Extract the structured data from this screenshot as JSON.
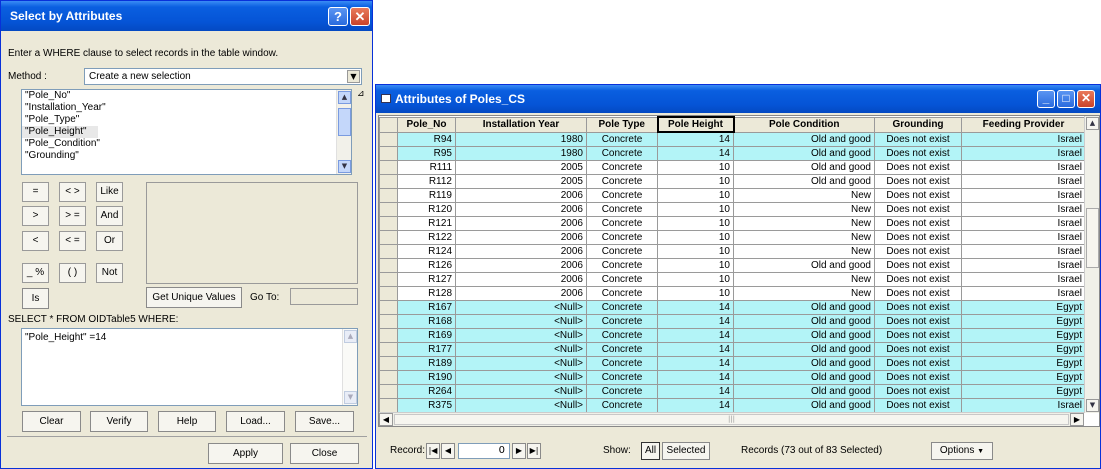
{
  "dialog": {
    "title": "Select by Attributes",
    "help_button": "?",
    "close_glyph": "✕",
    "instruction": "Enter a WHERE clause to select records in the table window.",
    "method_label": "Method :",
    "method_value": "Create a new selection",
    "fields": [
      "\"Pole_No\"",
      "\"Installation_Year\"",
      "\"Pole_Type\"",
      "\"Pole_Height\"",
      "\"Pole_Condition\"",
      "\"Grounding\""
    ],
    "selected_field_index": 3,
    "operators": [
      "=",
      "< >",
      "Like",
      ">",
      "> =",
      "And",
      "<",
      "< =",
      "Or",
      "_ %",
      "( )",
      "Not"
    ],
    "is_button": "Is",
    "get_unique_values": "Get Unique Values",
    "goto_label": "Go To:",
    "select_from": "SELECT * FROM OIDTable5 WHERE:",
    "where_clause": "\"Pole_Height\" =14",
    "buttons": {
      "clear": "Clear",
      "verify": "Verify",
      "help": "Help",
      "load": "Load...",
      "save": "Save..."
    },
    "apply": "Apply",
    "close": "Close"
  },
  "table_window": {
    "title": "Attributes of Poles_CS",
    "columns": [
      "Pole_No",
      "Installation Year",
      "Pole Type",
      "Pole Height",
      "Pole Condition",
      "Grounding",
      "Feeding Provider"
    ],
    "rows": [
      [
        "R94",
        "1980",
        "Concrete",
        "14",
        "Old and good",
        "Does not exist",
        "Israel"
      ],
      [
        "R95",
        "1980",
        "Concrete",
        "14",
        "Old and good",
        "Does not exist",
        "Israel"
      ],
      [
        "R111",
        "2005",
        "Concrete",
        "10",
        "Old and good",
        "Does not exist",
        "Israel"
      ],
      [
        "R112",
        "2005",
        "Concrete",
        "10",
        "Old and good",
        "Does not exist",
        "Israel"
      ],
      [
        "R119",
        "2006",
        "Concrete",
        "10",
        "New",
        "Does not exist",
        "Israel"
      ],
      [
        "R120",
        "2006",
        "Concrete",
        "10",
        "New",
        "Does not exist",
        "Israel"
      ],
      [
        "R121",
        "2006",
        "Concrete",
        "10",
        "New",
        "Does not exist",
        "Israel"
      ],
      [
        "R122",
        "2006",
        "Concrete",
        "10",
        "New",
        "Does not exist",
        "Israel"
      ],
      [
        "R124",
        "2006",
        "Concrete",
        "10",
        "New",
        "Does not exist",
        "Israel"
      ],
      [
        "R126",
        "2006",
        "Concrete",
        "10",
        "Old and good",
        "Does not exist",
        "Israel"
      ],
      [
        "R127",
        "2006",
        "Concrete",
        "10",
        "New",
        "Does not exist",
        "Israel"
      ],
      [
        "R128",
        "2006",
        "Concrete",
        "10",
        "New",
        "Does not exist",
        "Israel"
      ],
      [
        "R167",
        "<Null>",
        "Concrete",
        "14",
        "Old and good",
        "Does not exist",
        "Egypt"
      ],
      [
        "R168",
        "<Null>",
        "Concrete",
        "14",
        "Old and good",
        "Does not exist",
        "Egypt"
      ],
      [
        "R169",
        "<Null>",
        "Concrete",
        "14",
        "Old and good",
        "Does not exist",
        "Egypt"
      ],
      [
        "R177",
        "<Null>",
        "Concrete",
        "14",
        "Old and good",
        "Does not exist",
        "Egypt"
      ],
      [
        "R189",
        "<Null>",
        "Concrete",
        "14",
        "Old and good",
        "Does not exist",
        "Egypt"
      ],
      [
        "R190",
        "<Null>",
        "Concrete",
        "14",
        "Old and good",
        "Does not exist",
        "Egypt"
      ],
      [
        "R264",
        "<Null>",
        "Concrete",
        "14",
        "Old and good",
        "Does not exist",
        "Egypt"
      ],
      [
        "R375",
        "<Null>",
        "Concrete",
        "14",
        "Old and good",
        "Does not exist",
        "Israel"
      ]
    ],
    "selected_rows": [
      0,
      1,
      12,
      13,
      14,
      15,
      16,
      17,
      18,
      19
    ],
    "record_label": "Record:",
    "record_value": "0",
    "show_label": "Show:",
    "show_all": "All",
    "show_selected": "Selected",
    "records_summary": "Records (73 out of 83 Selected)",
    "options": "Options",
    "colors": {
      "selected_row": "#b3f4f7",
      "title_bar": "#0554d6"
    }
  }
}
